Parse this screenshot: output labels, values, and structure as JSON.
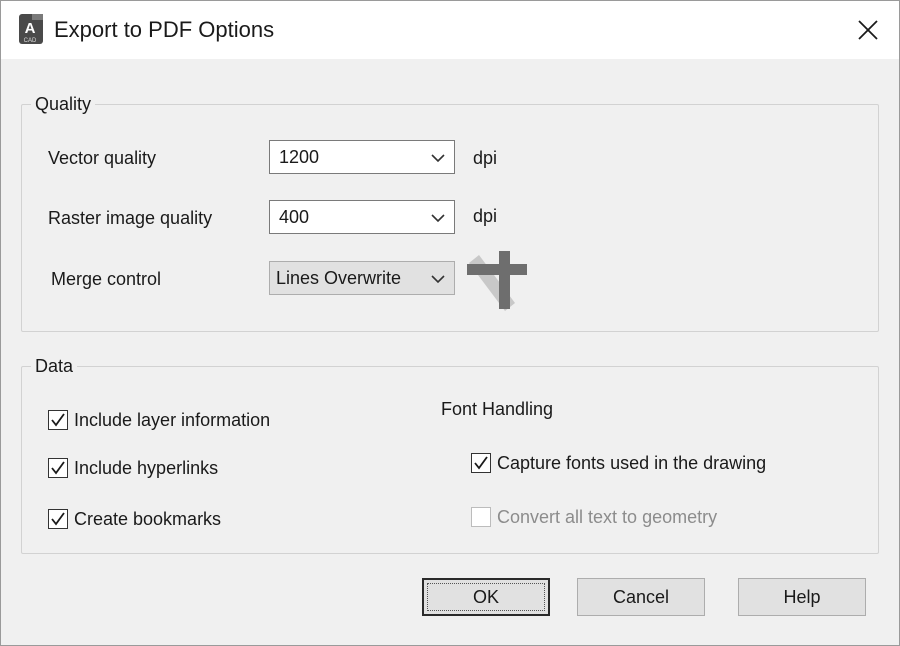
{
  "window": {
    "title": "Export to PDF Options",
    "app_icon_letter": "A",
    "app_icon_caption": "CAD"
  },
  "quality": {
    "group_label": "Quality",
    "vector_quality_label": "Vector quality",
    "vector_quality_value": "1200",
    "vector_unit": "dpi",
    "raster_quality_label": "Raster image quality",
    "raster_quality_value": "400",
    "raster_unit": "dpi",
    "merge_control_label": "Merge control",
    "merge_control_value": "Lines Overwrite"
  },
  "data": {
    "group_label": "Data",
    "include_layer_info": {
      "label": "Include layer information",
      "checked": true
    },
    "include_hyperlinks": {
      "label": "Include hyperlinks",
      "checked": true
    },
    "create_bookmarks": {
      "label": "Create bookmarks",
      "checked": true
    },
    "font_handling_label": "Font Handling",
    "capture_fonts": {
      "label": "Capture fonts used in the drawing",
      "checked": true
    },
    "convert_text": {
      "label": "Convert all text to geometry",
      "checked": false,
      "enabled": false
    }
  },
  "buttons": {
    "ok": "OK",
    "cancel": "Cancel",
    "help": "Help"
  }
}
